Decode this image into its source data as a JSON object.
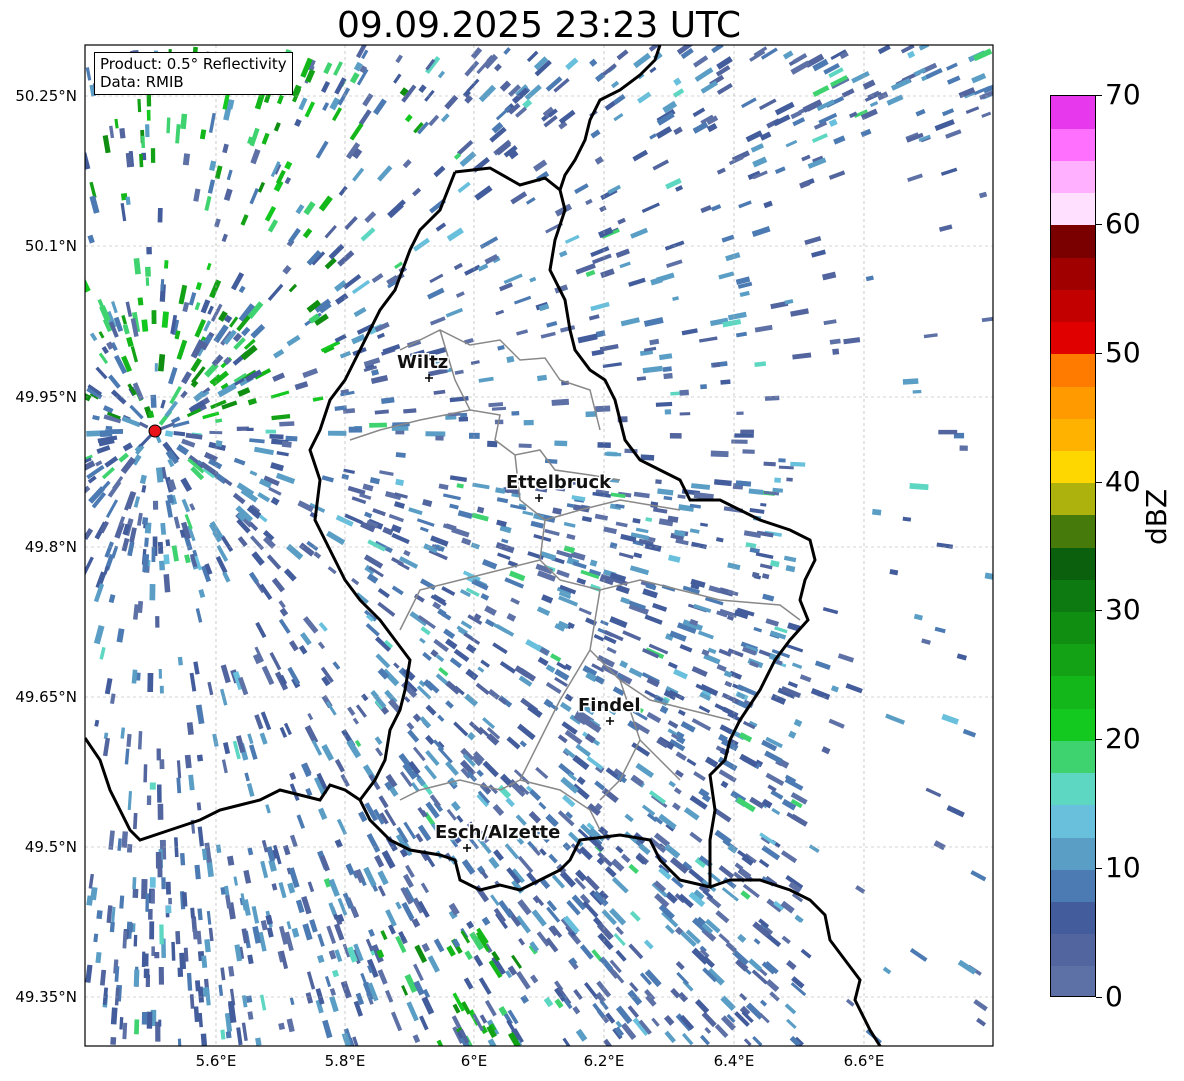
{
  "title": "09.09.2025 23:23 UTC",
  "info": {
    "product": "Product: 0.5° Reflectivity",
    "data": "Data: RMIB"
  },
  "latitude_labels": [
    "50.25°N",
    "50.1°N",
    "49.95°N",
    "49.8°N",
    "49.65°N",
    "49.5°N",
    "49.35°N"
  ],
  "longitude_labels": [
    "5.6°E",
    "5.8°E",
    "6°E",
    "6.2°E",
    "6.4°E",
    "6.6°E"
  ],
  "cities": [
    {
      "name": "Wiltz"
    },
    {
      "name": "Ettelbruck"
    },
    {
      "name": "Findel"
    },
    {
      "name": "Esch/Alzette"
    }
  ],
  "colorbar": {
    "unit": "dBZ",
    "min": 0,
    "max": 70,
    "tick_labels": [
      "0",
      "10",
      "20",
      "30",
      "40",
      "50",
      "60",
      "70"
    ],
    "colors": [
      "#5e71a6",
      "#52659e",
      "#425c9c",
      "#4c7ab2",
      "#5a9ec6",
      "#68c0dc",
      "#5ed7c2",
      "#3fd370",
      "#13c81f",
      "#13b71a",
      "#13a216",
      "#0f8e12",
      "#0c7a10",
      "#0a600c",
      "#467a0b",
      "#adb30c",
      "#ffd700",
      "#ffb300",
      "#ff9a00",
      "#ff7b00",
      "#e10000",
      "#c30000",
      "#a00000",
      "#7a0000",
      "#ffe0ff",
      "#ffb0ff",
      "#ff70ff",
      "#e838ee"
    ]
  },
  "radar_site_color": "#e8141a"
}
